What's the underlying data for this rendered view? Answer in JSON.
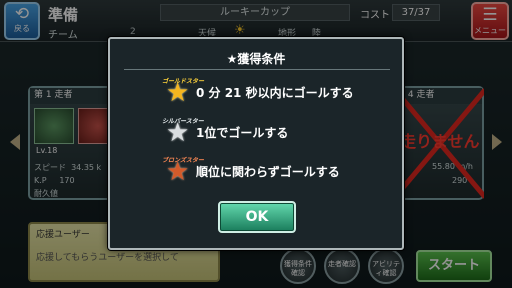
{
  "header": {
    "back_icon": "back-arrow-icon",
    "back_label": "戻る",
    "screen_title": "準備",
    "team_label": "チーム",
    "team_value": "2",
    "cup_name": "ルーキーカップ",
    "weather_label": "天候",
    "weather_icon": "sun-icon",
    "terrain_label": "地形",
    "terrain_value": "陸",
    "cost_label": "コスト",
    "cost_value": "37/37",
    "menu_icon": "list-icon",
    "menu_label": "メニュー"
  },
  "runners": {
    "left_card": {
      "header": "第 1 走者",
      "level": "Lv.18",
      "speed_label": "スピード",
      "speed_value": "34.35 k",
      "kp_label": "K.P",
      "kp_value": "170",
      "durability_label": "耐久値"
    },
    "right_card": {
      "header": "第 4 走者",
      "status_text": "走りません",
      "speed_value": "55.80 m/h",
      "kp_value": "290"
    }
  },
  "support": {
    "title": "応援ユーザー",
    "text": "応援してもらうユーザーを選択して"
  },
  "footer": {
    "conditions_button": "獲得条件確認",
    "runner_button": "走者確認",
    "ability_button": "アビリティ確認",
    "start_button": "スタート"
  },
  "modal": {
    "title": "★獲得条件",
    "conditions": [
      {
        "rank": "ゴールドスター",
        "icon": "gold-star-icon",
        "text": "0 分 21 秒以内にゴールする"
      },
      {
        "rank": "シルバースター",
        "icon": "silver-star-icon",
        "text": "1位でゴールする"
      },
      {
        "rank": "ブロンズスター",
        "icon": "bronze-star-icon",
        "text": "順位に関わらずゴールする"
      }
    ],
    "ok_label": "OK"
  },
  "colors": {
    "gold": "#f4b51f",
    "silver": "#d9dde0",
    "bronze": "#d35b2b",
    "ok_button": "#2ea67a",
    "menu_red": "#d9302b",
    "back_blue": "#2f86cc"
  }
}
